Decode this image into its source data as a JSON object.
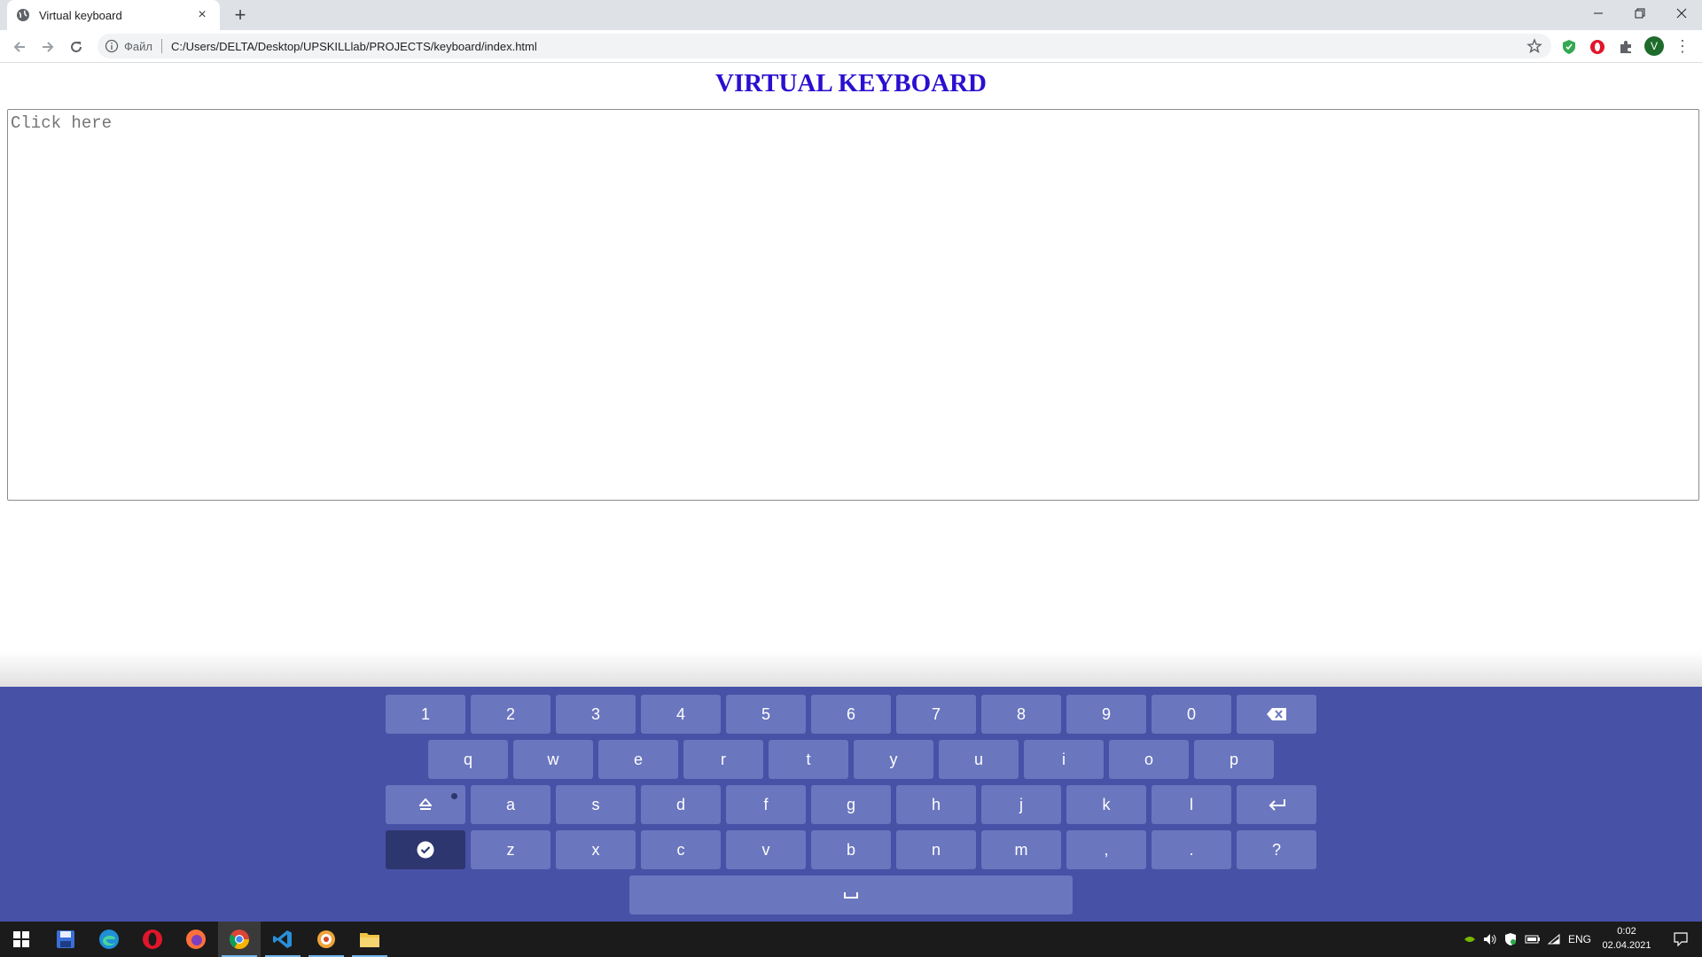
{
  "browser": {
    "tab_title": "Virtual keyboard",
    "tab_close": "×",
    "new_tab": "+",
    "url_scheme": "Файл",
    "url": "C:/Users/DELTA/Desktop/UPSKILLlab/PROJECTS/keyboard/index.html",
    "profile_initial": "V",
    "menu": "⋮"
  },
  "page": {
    "title": "VIRTUAL KEYBOARD",
    "textarea_placeholder": "Click here"
  },
  "keyboard": {
    "row1": [
      "1",
      "2",
      "3",
      "4",
      "5",
      "6",
      "7",
      "8",
      "9",
      "0"
    ],
    "row2": [
      "q",
      "w",
      "e",
      "r",
      "t",
      "y",
      "u",
      "i",
      "o",
      "p"
    ],
    "row3": [
      "a",
      "s",
      "d",
      "f",
      "g",
      "h",
      "j",
      "k",
      "l"
    ],
    "row4": [
      "z",
      "x",
      "c",
      "v",
      "b",
      "n",
      "m",
      ",",
      ".",
      "?"
    ],
    "icons": {
      "backspace": "backspace-icon",
      "shift": "shift-icon",
      "enter": "enter-icon",
      "done": "check-circle-icon",
      "space": "space-icon"
    },
    "colors": {
      "background": "#4751a6",
      "key": "#6a76be",
      "key_dark": "#2e366f"
    }
  },
  "taskbar": {
    "lang": "ENG",
    "time": "0:02",
    "date": "02.04.2021"
  }
}
